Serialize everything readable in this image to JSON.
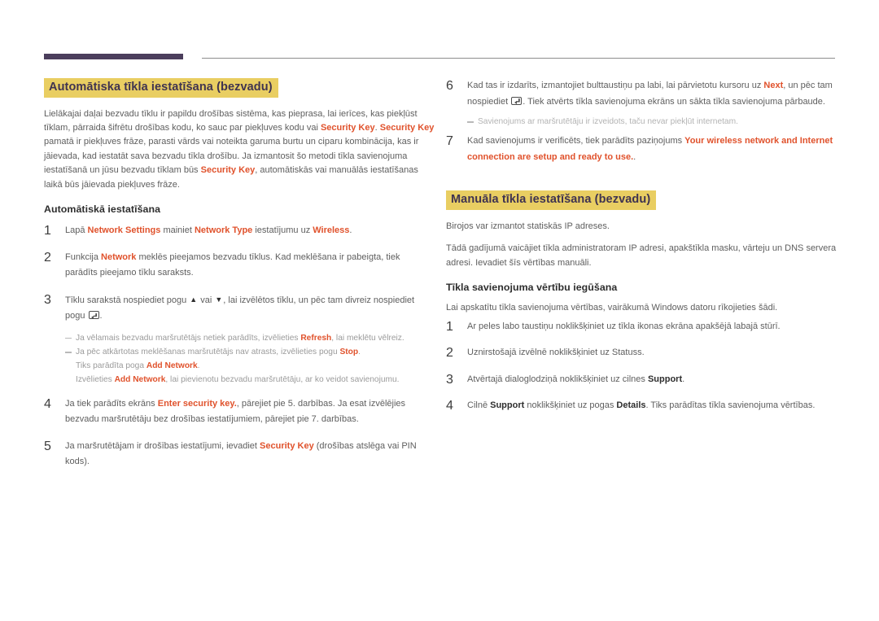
{
  "colors": {
    "accent": "#e0522c",
    "heading_highlight": "#e9ce62",
    "heading_text": "#3f3350",
    "rule_thick": "#4b3e5c",
    "rule_thin": "#8d8d8d",
    "body_text": "#5e5e5e",
    "note_text": "#9b9b9b"
  },
  "left_column": {
    "section_heading": "Automātiska tīkla iestatīšana (bezvadu)",
    "intro_paragraph": {
      "p1": "Lielākajai daļai bezvadu tīklu ir papildu drošības sistēma, kas pieprasa, lai ierīces, kas piekļūst tīklam, pārraida šifrētu drošības kodu, ko sauc par piekļuves kodu vai ",
      "em1": "Security Key",
      "p2": ". ",
      "em2": "Security Key",
      "p3": " pamatā ir piekļuves frāze, parasti vārds vai noteikta garuma burtu un ciparu kombinācija, kas ir jāievada, kad iestatāt sava bezvadu tīkla drošību. Ja izmantosit šo metodi tīkla savienojuma iestatīšanā un jūsu bezvadu tīklam būs ",
      "em3": "Security Key",
      "p4": ", automātiskās vai manuālās iestatīšanas laikā būs jāievada piekļuves frāze."
    },
    "sub_heading": "Automātiskā iestatīšana",
    "steps": [
      {
        "num": "1",
        "parts": [
          {
            "t": "Lapā ",
            "s": "plain"
          },
          {
            "t": "Network Settings",
            "s": "accent"
          },
          {
            "t": " mainiet ",
            "s": "plain"
          },
          {
            "t": "Network Type",
            "s": "accent"
          },
          {
            "t": " iestatījumu uz ",
            "s": "plain"
          },
          {
            "t": "Wireless",
            "s": "accent"
          },
          {
            "t": ".",
            "s": "plain"
          }
        ]
      },
      {
        "num": "2",
        "parts": [
          {
            "t": "Funkcija ",
            "s": "plain"
          },
          {
            "t": "Network",
            "s": "accent"
          },
          {
            "t": " meklēs pieejamos bezvadu tīklus. Kad meklēšana ir pabeigta, tiek parādīts pieejamo tīklu saraksts.",
            "s": "plain"
          }
        ]
      },
      {
        "num": "3",
        "parts": [
          {
            "t": "Tīklu sarakstā nospiediet pogu ",
            "s": "plain"
          },
          {
            "t": "▲",
            "s": "glyph"
          },
          {
            "t": " vai ",
            "s": "plain"
          },
          {
            "t": "▼",
            "s": "glyph"
          },
          {
            "t": ", lai izvēlētos tīklu, un pēc tam divreiz nospiediet pogu ",
            "s": "plain"
          },
          {
            "t": "enter-key",
            "s": "enterkey"
          },
          {
            "t": ".",
            "s": "plain"
          }
        ]
      }
    ],
    "notes": [
      {
        "parts": [
          {
            "t": "Ja vēlamais bezvadu maršrutētājs netiek parādīts, izvēlieties ",
            "s": "plain"
          },
          {
            "t": "Refresh",
            "s": "accent"
          },
          {
            "t": ", lai meklētu vēlreiz.",
            "s": "plain"
          }
        ]
      },
      {
        "parts": [
          {
            "t": "Ja pēc atkārtotas meklēšanas maršrutētājs nav atrasts, izvēlieties pogu ",
            "s": "plain"
          },
          {
            "t": "Stop",
            "s": "accent"
          },
          {
            "t": ".",
            "s": "plain"
          }
        ]
      }
    ],
    "note_sublines": [
      {
        "parts": [
          {
            "t": "Tiks parādīta poga ",
            "s": "plain"
          },
          {
            "t": "Add Network",
            "s": "accent"
          },
          {
            "t": ".",
            "s": "plain"
          }
        ]
      },
      {
        "parts": [
          {
            "t": "Izvēlieties ",
            "s": "plain"
          },
          {
            "t": "Add Network",
            "s": "accent"
          },
          {
            "t": ", lai pievienotu bezvadu maršrutētāju, ar ko veidot savienojumu.",
            "s": "plain"
          }
        ]
      }
    ],
    "steps_after_notes": [
      {
        "num": "4",
        "parts": [
          {
            "t": "Ja tiek parādīts ekrāns ",
            "s": "plain"
          },
          {
            "t": "Enter security key.",
            "s": "accent"
          },
          {
            "t": ", pārejiet pie 5. darbības. Ja esat izvēlējies bezvadu maršrutētāju bez drošības iestatījumiem, pārejiet pie 7. darbības.",
            "s": "plain"
          }
        ]
      },
      {
        "num": "5",
        "parts": [
          {
            "t": "Ja maršrutētājam ir drošības iestatījumi, ievadiet ",
            "s": "plain"
          },
          {
            "t": "Security Key",
            "s": "accent"
          },
          {
            "t": " (drošības atslēga vai PIN kods).",
            "s": "plain"
          }
        ]
      }
    ]
  },
  "right_column": {
    "steps_top": [
      {
        "num": "6",
        "parts": [
          {
            "t": "Kad tas ir izdarīts, izmantojiet bulttaustiņu pa labi, lai pārvietotu kursoru uz ",
            "s": "plain"
          },
          {
            "t": "Next",
            "s": "accent"
          },
          {
            "t": ", un pēc tam nospiediet ",
            "s": "plain"
          },
          {
            "t": "enter-key",
            "s": "enterkey"
          },
          {
            "t": ". Tiek atvērts tīkla savienojuma ekrāns un sākta tīkla savienojuma pārbaude.",
            "s": "plain"
          }
        ]
      }
    ],
    "note_after_six": {
      "parts": [
        {
          "t": "Savienojums ar maršrutētāju ir izveidots, taču nevar piekļūt internetam.",
          "s": "plain"
        }
      ]
    },
    "step_seven": {
      "num": "7",
      "parts": [
        {
          "t": "Kad savienojums ir verificēts, tiek parādīts paziņojums ",
          "s": "plain"
        },
        {
          "t": "Your wireless network and Internet connection are setup and ready to use.",
          "s": "accent"
        },
        {
          "t": ".",
          "s": "plain"
        }
      ]
    },
    "section_heading": "Manuāla tīkla iestatīšana (bezvadu)",
    "para_1": "Birojos var izmantot statiskās IP adreses.",
    "para_2": "Tādā gadījumā vaicājiet tīkla administratoram IP adresi, apakštīkla masku, vārteju un DNS servera adresi. Ievadiet šīs vērtības manuāli.",
    "sub_heading": "Tīkla savienojuma vērtību iegūšana",
    "para_3": "Lai apskatītu tīkla savienojuma vērtības, vairākumā Windows datoru rīkojieties šādi.",
    "steps_bottom": [
      {
        "num": "1",
        "parts": [
          {
            "t": "Ar peles labo taustiņu noklikšķiniet uz tīkla ikonas ekrāna apakšējā labajā stūrī.",
            "s": "plain"
          }
        ]
      },
      {
        "num": "2",
        "parts": [
          {
            "t": "Uznirstošajā izvēlnē noklikšķiniet uz Statuss.",
            "s": "plain"
          }
        ]
      },
      {
        "num": "3",
        "parts": [
          {
            "t": "Atvērtajā dialoglodziņā noklikšķiniet uz cilnes ",
            "s": "plain"
          },
          {
            "t": "Support",
            "s": "dark"
          },
          {
            "t": ".",
            "s": "plain"
          }
        ]
      },
      {
        "num": "4",
        "parts": [
          {
            "t": "Cilnē ",
            "s": "plain"
          },
          {
            "t": "Support",
            "s": "dark"
          },
          {
            "t": " noklikšķiniet uz pogas ",
            "s": "plain"
          },
          {
            "t": "Details",
            "s": "dark"
          },
          {
            "t": ". Tiks parādītas tīkla savienojuma vērtības.",
            "s": "plain"
          }
        ]
      }
    ]
  }
}
